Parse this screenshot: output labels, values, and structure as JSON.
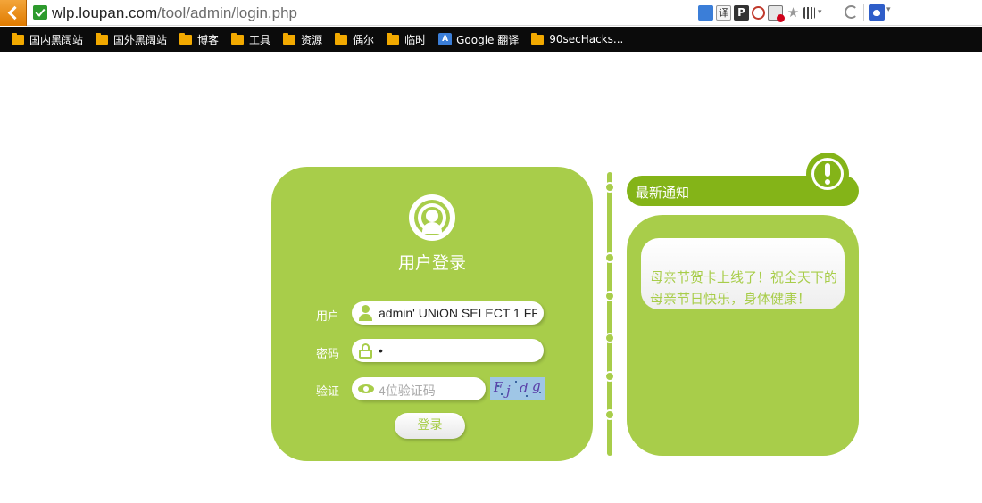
{
  "browser": {
    "url_host": "wlp.loupan.com",
    "url_path": "/tool/admin/login.php",
    "extensions": {
      "translate_icon": "translate-icon",
      "yi_label": "译",
      "p_label": "P",
      "star": "★"
    },
    "bookmarks": [
      {
        "label": "国内黑阔站",
        "icon": "folder-icon"
      },
      {
        "label": "国外黑阔站",
        "icon": "folder-icon"
      },
      {
        "label": "博客",
        "icon": "folder-icon"
      },
      {
        "label": "工具",
        "icon": "folder-icon"
      },
      {
        "label": "资源",
        "icon": "folder-icon"
      },
      {
        "label": "偶尔",
        "icon": "folder-icon"
      },
      {
        "label": "临时",
        "icon": "folder-icon"
      },
      {
        "label": "Google 翻译",
        "icon": "google-translate-icon"
      },
      {
        "label": "90secHacks...",
        "icon": "folder-icon"
      }
    ]
  },
  "login": {
    "title": "用户登录",
    "user_label": "用户",
    "user_value": "admin' UNiON SELECT 1 FR",
    "password_label": "密码",
    "password_value": "•",
    "captcha_label": "验证",
    "captcha_placeholder": "4位验证码",
    "captcha_chars": [
      "F",
      "j",
      "d",
      "g"
    ],
    "submit_label": "登录"
  },
  "notice": {
    "title": "最新通知",
    "text": "母亲节贺卡上线了！祝全天下的母亲节日快乐，身体健康！"
  },
  "colors": {
    "accent": "#a8cd4a",
    "accent_dark": "#84b418"
  }
}
